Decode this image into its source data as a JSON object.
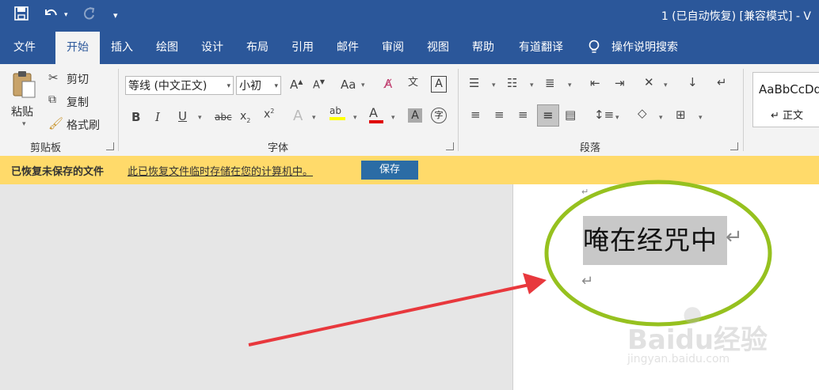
{
  "window": {
    "title": "1 (已自动恢复) [兼容模式] - V"
  },
  "quick_access": {
    "save_icon": "save-icon",
    "undo_icon": "undo-icon",
    "redo_icon": "redo-icon",
    "customize_icon": "customize-icon"
  },
  "tabs": [
    {
      "label": "文件"
    },
    {
      "label": "开始"
    },
    {
      "label": "插入"
    },
    {
      "label": "绘图"
    },
    {
      "label": "设计"
    },
    {
      "label": "布局"
    },
    {
      "label": "引用"
    },
    {
      "label": "邮件"
    },
    {
      "label": "审阅"
    },
    {
      "label": "视图"
    },
    {
      "label": "帮助"
    },
    {
      "label": "有道翻译"
    }
  ],
  "tell_me": {
    "label": "操作说明搜索"
  },
  "clipboard": {
    "paste_label": "粘贴",
    "cut_label": "剪切",
    "copy_label": "复制",
    "format_painter_label": "格式刷",
    "group_label": "剪贴板"
  },
  "font": {
    "font_name": "等线 (中文正文)",
    "font_size": "小初",
    "group_label": "字体"
  },
  "paragraph": {
    "group_label": "段落"
  },
  "styles": {
    "preview_text": "AaBbCcDd",
    "style_name": "正文"
  },
  "notice": {
    "title": "已恢复未保存的文件",
    "message": "此已恢复文件临时存储在您的计算机中。",
    "save_label": "保存"
  },
  "document": {
    "text": "唵在经咒中"
  },
  "watermark": {
    "brand": "Baidu经验",
    "url": "jingyan.baidu.com"
  },
  "colors": {
    "brand_blue": "#2b579a",
    "notice_yellow": "#ffda6a",
    "annotation_green": "#96c11f",
    "annotation_red": "#e8383d"
  }
}
